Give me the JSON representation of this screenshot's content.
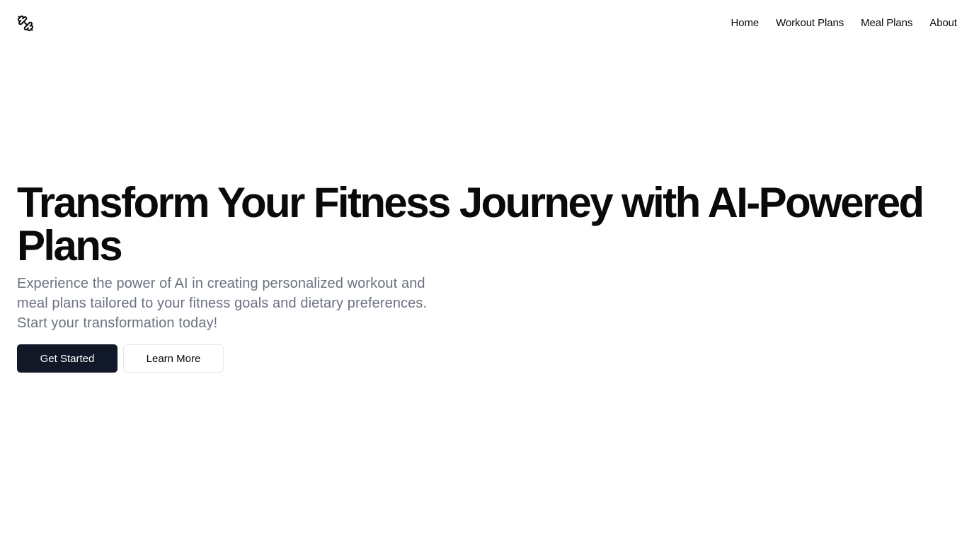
{
  "header": {
    "logo_icon": "dumbbell-icon",
    "nav": [
      {
        "label": "Home"
      },
      {
        "label": "Workout Plans"
      },
      {
        "label": "Meal Plans"
      },
      {
        "label": "About"
      }
    ]
  },
  "hero": {
    "title": "Transform Your Fitness Journey with AI-Powered Plans",
    "subtitle": "Experience the power of AI in creating personalized workout and meal plans tailored to your fitness goals and dietary preferences. Start your transformation today!",
    "primary_button": "Get Started",
    "secondary_button": "Learn More"
  },
  "colors": {
    "text": "#0a0a0a",
    "muted": "#6b7280",
    "primary_bg": "#111827",
    "border": "#e5e7eb",
    "background": "#ffffff"
  }
}
